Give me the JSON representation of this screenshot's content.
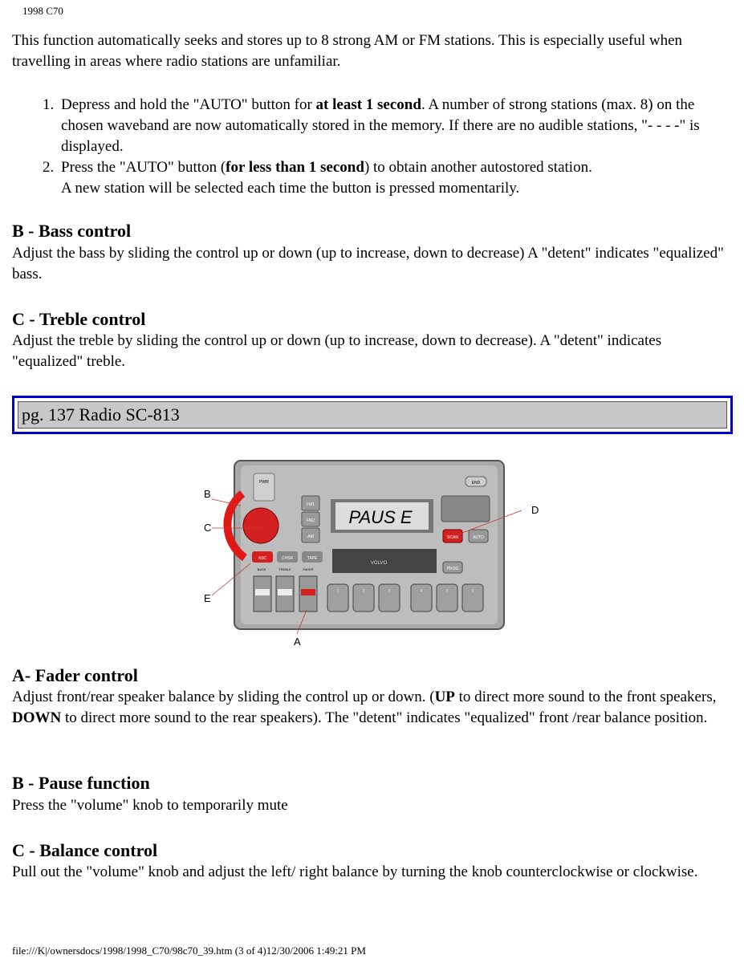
{
  "header": "1998 C70",
  "intro": "This function automatically seeks and stores up to 8 strong AM or FM stations. This is especially useful when travelling in areas where radio stations are unfamiliar.",
  "steps": [
    {
      "num": "1.",
      "pre": "Depress and hold the \"AUTO\" button for ",
      "bold": "at least 1 second",
      "post": ". A number of strong stations (max. 8) on the chosen waveband are now automatically stored in the memory. If there are no audible stations, \"- - - -\" is displayed."
    },
    {
      "num": "2.",
      "pre": "Press the \"AUTO\" button (",
      "bold": "for less than 1 second",
      "post": ") to obtain another autostored station.",
      "line2": "A new station will be selected each time the button is pressed momentarily."
    }
  ],
  "bass": {
    "title": "B - Bass control",
    "text": "Adjust the bass by sliding the control up or down (up to increase, down to decrease) A \"detent\" indicates \"equalized\" bass."
  },
  "treble": {
    "title": "C - Treble control",
    "text": "Adjust the treble by sliding the control up or down (up to increase, down to decrease). A \"detent\" indicates \"equalized\" treble."
  },
  "banner": "pg. 137 Radio SC-813",
  "figure": {
    "display": "PAUS E",
    "callouts": [
      "A",
      "B",
      "C",
      "D",
      "E"
    ],
    "buttons": {
      "fm1": "FM1",
      "fm2": "FM2",
      "am": "AM",
      "asc": "ASC",
      "chsr": "CHSR",
      "tape": "TAPE",
      "scan": "SCAN",
      "auto": "AUTO",
      "prog": "PROG",
      "pwr": "PWR",
      "end": "END",
      "bass": "BASS",
      "treble": "TREBLE",
      "fader": "FADER",
      "brand": "VOLVO"
    },
    "presets": [
      "1",
      "2",
      "3",
      "4",
      "5",
      "6"
    ]
  },
  "fader": {
    "title": "A- Fader control",
    "pre": "Adjust front/rear speaker balance by sliding the control up or down. (",
    "b1": "UP",
    "mid": " to direct more sound to the front speakers, ",
    "b2": "DOWN",
    "post": " to direct more sound to the rear speakers). The \"detent\" indicates \"equalized\" front /rear balance position."
  },
  "pause": {
    "title": "B - Pause function",
    "text": "Press the \"volume\" knob to temporarily mute"
  },
  "balance": {
    "title": "C - Balance control",
    "text": "Pull out the \"volume\" knob and adjust the left/ right balance by turning the knob counterclockwise or clockwise."
  },
  "footer": "file:///K|/ownersdocs/1998/1998_C70/98c70_39.htm (3 of 4)12/30/2006 1:49:21 PM"
}
